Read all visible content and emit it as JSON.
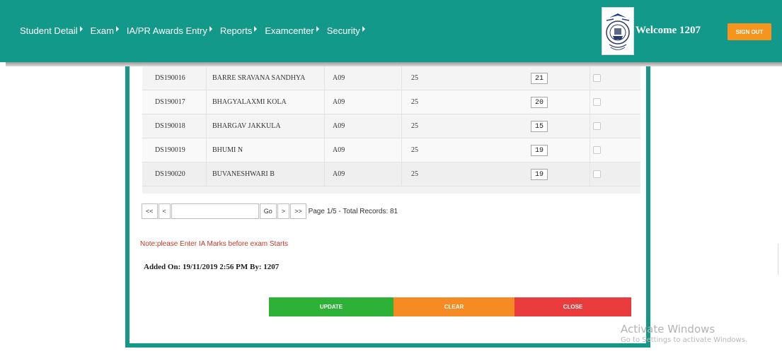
{
  "nav": {
    "items": [
      "Student Detail",
      "Exam",
      "IA/PR Awards Entry",
      "Reports",
      "Examcenter",
      "Security"
    ]
  },
  "header": {
    "welcome": "Welcome 1207",
    "signout_label": "SIGN OUT",
    "logo_icon": "university-seal-logo"
  },
  "table": {
    "rows": [
      {
        "roll": "DS190016",
        "name": "BARRE SRAVANA SANDHYA",
        "code": "A09",
        "max": "25",
        "mark": "21",
        "checked": false
      },
      {
        "roll": "DS190017",
        "name": "BHAGYALAXMI KOLA",
        "code": "A09",
        "max": "25",
        "mark": "20",
        "checked": false
      },
      {
        "roll": "DS190018",
        "name": "BHARGAV JAKKULA",
        "code": "A09",
        "max": "25",
        "mark": "15",
        "checked": false
      },
      {
        "roll": "DS190019",
        "name": "BHUMI N",
        "code": "A09",
        "max": "25",
        "mark": "19",
        "checked": false
      },
      {
        "roll": "DS190020",
        "name": "BUVANESHWARI B",
        "code": "A09",
        "max": "25",
        "mark": "19",
        "checked": false
      }
    ]
  },
  "pager": {
    "first": "<<",
    "prev": "<",
    "go": "Go",
    "next": ">",
    "last": ">>",
    "page_input": "",
    "status": "Page 1/5 - Total Records: 81"
  },
  "note": "Note:please Enter IA Marks before exam Starts",
  "added_on": "Added On: 19/11/2019 2:56 PM By: 1207",
  "actions": {
    "update": "UPDATE",
    "clear": "CLEAR",
    "close": "CLOSE"
  },
  "watermark": {
    "line1": "Activate Windows",
    "line2": "Go to Settings to activate Windows."
  },
  "colors": {
    "brand": "#13998a",
    "signout": "#f7941d",
    "update": "#2eb137",
    "clear": "#f58b22",
    "close": "#ea3c3c",
    "note": "#c0392b"
  }
}
